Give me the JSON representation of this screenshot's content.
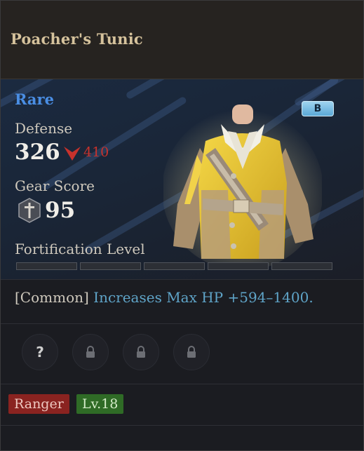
{
  "item": {
    "name": "Poacher's Tunic",
    "rarity": "Rare",
    "grade": "B",
    "defense": {
      "label": "Defense",
      "value": "326",
      "compare_value": "410",
      "compare_icon": "down-arrow-icon"
    },
    "gear_score": {
      "label": "Gear Score",
      "value": "95",
      "icon": "gear-score-icon"
    },
    "fortification": {
      "label": "Fortification Level",
      "segments_total": 5,
      "segments_filled": 0
    },
    "effect": {
      "tag": "[Common]",
      "text": "Increases Max HP +594–1400."
    },
    "sockets": [
      {
        "state": "unknown",
        "glyph": "?"
      },
      {
        "state": "locked",
        "icon": "lock-icon"
      },
      {
        "state": "locked",
        "icon": "lock-icon"
      },
      {
        "state": "locked",
        "icon": "lock-icon"
      }
    ],
    "tags": {
      "class": "Ranger",
      "level": "Lv.18"
    }
  },
  "colors": {
    "title": "#d5c29c",
    "rarity": "#4a8ee4",
    "down": "#c8322c",
    "effect": "#5fa4c8",
    "class_chip": "#8a2320",
    "level_chip": "#2f6b26"
  }
}
